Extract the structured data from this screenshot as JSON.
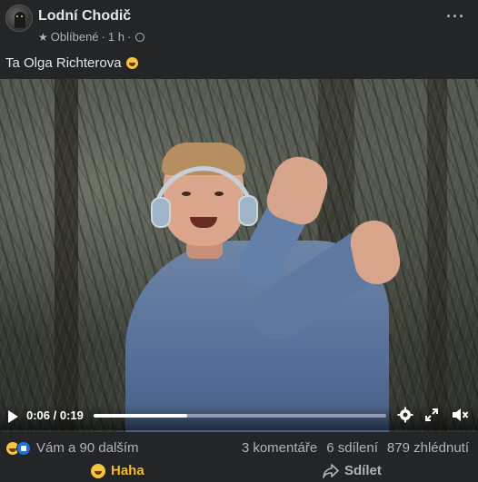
{
  "post": {
    "author": "Lodní Chodič",
    "meta_label": "Oblíbené",
    "meta_sep": "·",
    "time": "1 h",
    "meta_sep2": "·",
    "caption": "Ta Olga Richterova"
  },
  "video": {
    "current_time": "0:06",
    "duration": "0:19",
    "time_display": "0:06 / 0:19",
    "progress": 0.32
  },
  "stats": {
    "reactions_text": "Vám a 90 dalším",
    "comments": "3 komentáře",
    "shares": "6 sdílení",
    "views": "879 zhlédnutí"
  },
  "actions": {
    "haha_label": "Haha",
    "share_label": "Sdílet"
  },
  "icons": {
    "more": "more-options-icon",
    "star": "star-icon",
    "globe": "globe-icon",
    "play": "play-icon",
    "settings": "gear-icon",
    "fullscreen": "expand-icon",
    "mute": "speaker-muted-icon",
    "share": "share-arrow-icon"
  },
  "colors": {
    "background": "#242526",
    "text_primary": "#e4e6eb",
    "text_secondary": "#b0b3b8",
    "haha_accent": "#f7b928",
    "like_blue": "#1b74e4"
  }
}
